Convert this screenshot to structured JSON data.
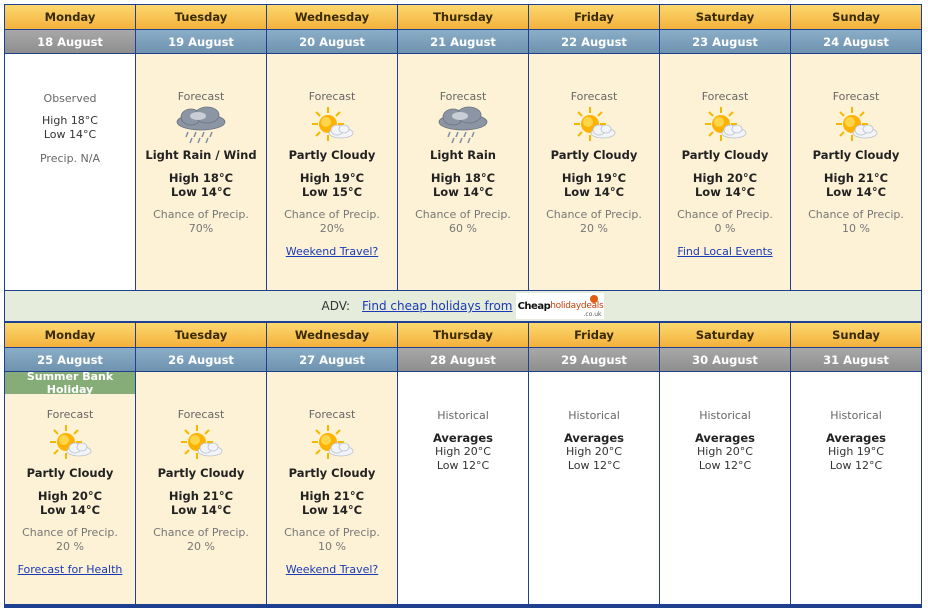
{
  "week1": [
    {
      "day": "Monday",
      "date": "18 August",
      "date_style": "gray",
      "bg": "white",
      "type": "observed",
      "label": "Observed",
      "high": "High 18°C",
      "low": "Low 14°C",
      "precip": "Precip. N/A"
    },
    {
      "day": "Tuesday",
      "date": "19 August",
      "type": "forecast",
      "label": "Forecast",
      "icon": "rain-icon",
      "condition": "Light Rain / Wind",
      "high": "High 18°C",
      "low": "Low 14°C",
      "chance_label": "Chance of Precip.",
      "chance": "70%"
    },
    {
      "day": "Wednesday",
      "date": "20 August",
      "type": "forecast",
      "label": "Forecast",
      "icon": "partly-cloudy-icon",
      "condition": "Partly Cloudy",
      "high": "High 19°C",
      "low": "Low 15°C",
      "chance_label": "Chance of Precip.",
      "chance": "20%",
      "link": "Weekend Travel?"
    },
    {
      "day": "Thursday",
      "date": "21 August",
      "type": "forecast",
      "label": "Forecast",
      "icon": "rain-icon",
      "condition": "Light Rain",
      "high": "High 18°C",
      "low": "Low 14°C",
      "chance_label": "Chance of Precip.",
      "chance": "60 %"
    },
    {
      "day": "Friday",
      "date": "22 August",
      "type": "forecast",
      "label": "Forecast",
      "icon": "partly-cloudy-icon",
      "condition": "Partly Cloudy",
      "high": "High 19°C",
      "low": "Low 14°C",
      "chance_label": "Chance of Precip.",
      "chance": "20 %"
    },
    {
      "day": "Saturday",
      "date": "23 August",
      "type": "forecast",
      "label": "Forecast",
      "icon": "partly-cloudy-icon",
      "condition": "Partly Cloudy",
      "high": "High 20°C",
      "low": "Low 14°C",
      "chance_label": "Chance of Precip.",
      "chance": "0 %",
      "link": "Find Local Events"
    },
    {
      "day": "Sunday",
      "date": "24 August",
      "type": "forecast",
      "label": "Forecast",
      "icon": "partly-cloudy-icon",
      "condition": "Partly Cloudy",
      "high": "High 21°C",
      "low": "Low 14°C",
      "chance_label": "Chance of Precip.",
      "chance": "10 %"
    }
  ],
  "adv": {
    "prefix": "ADV:",
    "link": "Find cheap holidays from",
    "logo_word1": "Cheap",
    "logo_word2": "holidaydeals",
    "logo_sub": ".co.uk"
  },
  "week2": [
    {
      "day": "Monday",
      "date": "25 August",
      "type": "forecast",
      "banner": "Summer Bank Holiday",
      "label": "Forecast",
      "icon": "partly-cloudy-icon",
      "condition": "Partly Cloudy",
      "high": "High 20°C",
      "low": "Low 14°C",
      "chance_label": "Chance of Precip.",
      "chance": "20 %",
      "link": "Forecast for Health"
    },
    {
      "day": "Tuesday",
      "date": "26 August",
      "type": "forecast",
      "label": "Forecast",
      "icon": "partly-cloudy-icon",
      "condition": "Partly Cloudy",
      "high": "High 21°C",
      "low": "Low 14°C",
      "chance_label": "Chance of Precip.",
      "chance": "20 %"
    },
    {
      "day": "Wednesday",
      "date": "27 August",
      "type": "forecast",
      "label": "Forecast",
      "icon": "partly-cloudy-icon",
      "condition": "Partly Cloudy",
      "high": "High 21°C",
      "low": "Low 14°C",
      "chance_label": "Chance of Precip.",
      "chance": "10 %",
      "link": "Weekend Travel?"
    },
    {
      "day": "Thursday",
      "date": "28 August",
      "date_style": "gray",
      "bg": "white",
      "type": "historical",
      "label": "Historical",
      "avg": "Averages",
      "high": "High 20°C",
      "low": "Low 12°C"
    },
    {
      "day": "Friday",
      "date": "29 August",
      "date_style": "gray",
      "bg": "white",
      "type": "historical",
      "label": "Historical",
      "avg": "Averages",
      "high": "High 20°C",
      "low": "Low 12°C"
    },
    {
      "day": "Saturday",
      "date": "30 August",
      "date_style": "gray",
      "bg": "white",
      "type": "historical",
      "label": "Historical",
      "avg": "Averages",
      "high": "High 20°C",
      "low": "Low 12°C"
    },
    {
      "day": "Sunday",
      "date": "31 August",
      "date_style": "gray",
      "bg": "white",
      "type": "historical",
      "label": "Historical",
      "avg": "Averages",
      "high": "High 19°C",
      "low": "Low 12°C"
    }
  ]
}
